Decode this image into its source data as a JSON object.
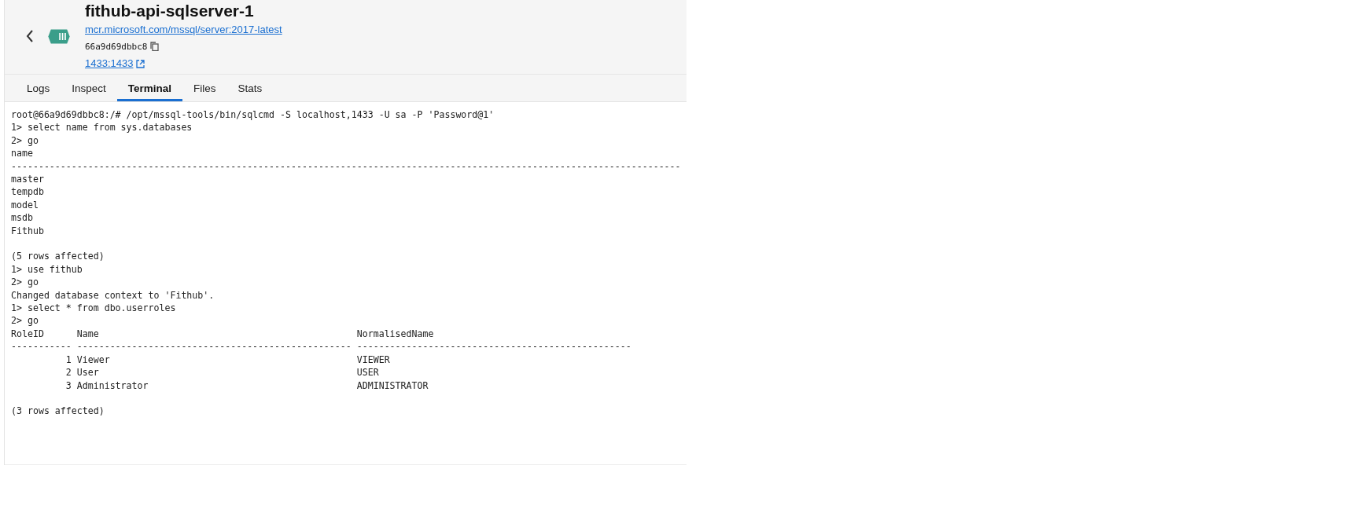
{
  "header": {
    "title": "fithub-api-sqlserver-1",
    "image_link": "mcr.microsoft.com/mssql/server:2017-latest",
    "container_id": "66a9d69dbbc8",
    "port_link": "1433:1433"
  },
  "tabs": [
    {
      "label": "Logs",
      "selected": false
    },
    {
      "label": "Inspect",
      "selected": false
    },
    {
      "label": "Terminal",
      "selected": true
    },
    {
      "label": "Files",
      "selected": false
    },
    {
      "label": "Stats",
      "selected": false
    }
  ],
  "terminal": {
    "lines": [
      {
        "kind": "text",
        "text": "root@66a9d69dbbc8:/# /opt/mssql-tools/bin/sqlcmd -S localhost,1433 -U sa -P 'Password@1'"
      },
      {
        "kind": "text",
        "text": "1> select name from sys.databases"
      },
      {
        "kind": "text",
        "text": "2> go"
      },
      {
        "kind": "text",
        "text": "name"
      },
      {
        "kind": "text",
        "text": "--------------------------------------------------------------------------------------------------------------------------"
      },
      {
        "kind": "text",
        "text": "master"
      },
      {
        "kind": "text",
        "text": "tempdb"
      },
      {
        "kind": "text",
        "text": "model"
      },
      {
        "kind": "text",
        "text": "msdb"
      },
      {
        "kind": "text",
        "text": "Fithub"
      },
      {
        "kind": "blank"
      },
      {
        "kind": "text",
        "text": "(5 rows affected)"
      },
      {
        "kind": "text",
        "text": "1> use fithub"
      },
      {
        "kind": "text",
        "text": "2> go"
      },
      {
        "kind": "text",
        "text": "Changed database context to 'Fithub'."
      },
      {
        "kind": "text",
        "text": "1> select * from dbo.userroles"
      },
      {
        "kind": "text",
        "text": "2> go"
      },
      {
        "kind": "text",
        "text": "RoleID      Name                                               NormalisedName"
      },
      {
        "kind": "text",
        "text": "----------- -------------------------------------------------- --------------------------------------------------"
      },
      {
        "kind": "text",
        "text": "          1 Viewer                                             VIEWER"
      },
      {
        "kind": "text",
        "text": "          2 User                                               USER"
      },
      {
        "kind": "text",
        "text": "          3 Administrator                                      ADMINISTRATOR"
      },
      {
        "kind": "blank"
      },
      {
        "kind": "text",
        "text": "(3 rows affected)"
      }
    ]
  }
}
